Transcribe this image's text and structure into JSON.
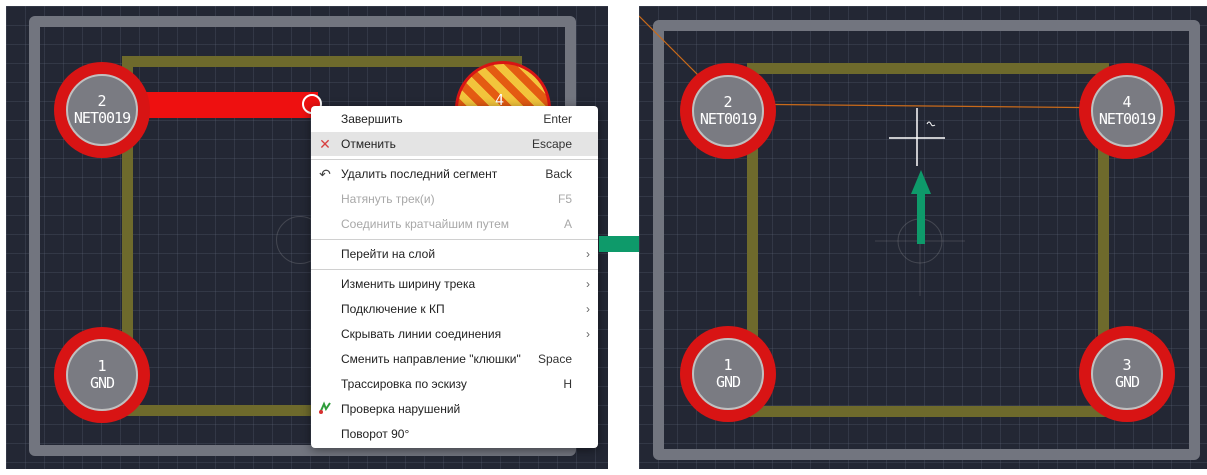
{
  "colors": {
    "canvas": "#232734",
    "board": "#72757f",
    "track": "#6e6a2c",
    "pad_ring": "#d81414",
    "pad_core": "#7a7b82",
    "arrow": "#0e9a6a",
    "menu_bg": "#ffffff"
  },
  "left_panel": {
    "pads": [
      {
        "num": "2",
        "net": "NET0019"
      },
      {
        "num": "1",
        "net": "GND"
      },
      {
        "num": "4",
        "net": ""
      }
    ]
  },
  "context_menu": {
    "items": [
      {
        "label": "Завершить",
        "key": "Enter",
        "icon": "",
        "disabled": false,
        "submenu": false
      },
      {
        "label": "Отменить",
        "key": "Escape",
        "icon": "cancel-x-icon",
        "disabled": false,
        "submenu": false
      },
      {
        "label": "Удалить последний сегмент",
        "key": "Back",
        "icon": "undo-arrow-icon",
        "disabled": false,
        "submenu": false
      },
      {
        "label": "Натянуть трек(и)",
        "key": "F5",
        "icon": "",
        "disabled": true,
        "submenu": false
      },
      {
        "label": "Соединить кратчайшим путем",
        "key": "A",
        "icon": "",
        "disabled": true,
        "submenu": false
      },
      {
        "label": "Перейти на слой",
        "key": "",
        "icon": "",
        "disabled": false,
        "submenu": true
      },
      {
        "label": "Изменить ширину трека",
        "key": "",
        "icon": "",
        "disabled": false,
        "submenu": true
      },
      {
        "label": "Подключение к КП",
        "key": "",
        "icon": "",
        "disabled": false,
        "submenu": true
      },
      {
        "label": "Скрывать линии соединения",
        "key": "",
        "icon": "",
        "disabled": false,
        "submenu": true
      },
      {
        "label": "Сменить направление \"клюшки\"",
        "key": "Space",
        "icon": "",
        "disabled": false,
        "submenu": false
      },
      {
        "label": "Трассировка по эскизу",
        "key": "H",
        "icon": "",
        "disabled": false,
        "submenu": false
      },
      {
        "label": "Проверка нарушений",
        "key": "",
        "icon": "drc-check-icon",
        "disabled": false,
        "submenu": false
      },
      {
        "label": "Поворот 90°",
        "key": "",
        "icon": "",
        "disabled": false,
        "submenu": false
      }
    ]
  },
  "right_panel": {
    "pads": [
      {
        "num": "2",
        "net": "NET0019"
      },
      {
        "num": "4",
        "net": "NET0019"
      },
      {
        "num": "1",
        "net": "GND"
      },
      {
        "num": "3",
        "net": "GND"
      }
    ]
  }
}
